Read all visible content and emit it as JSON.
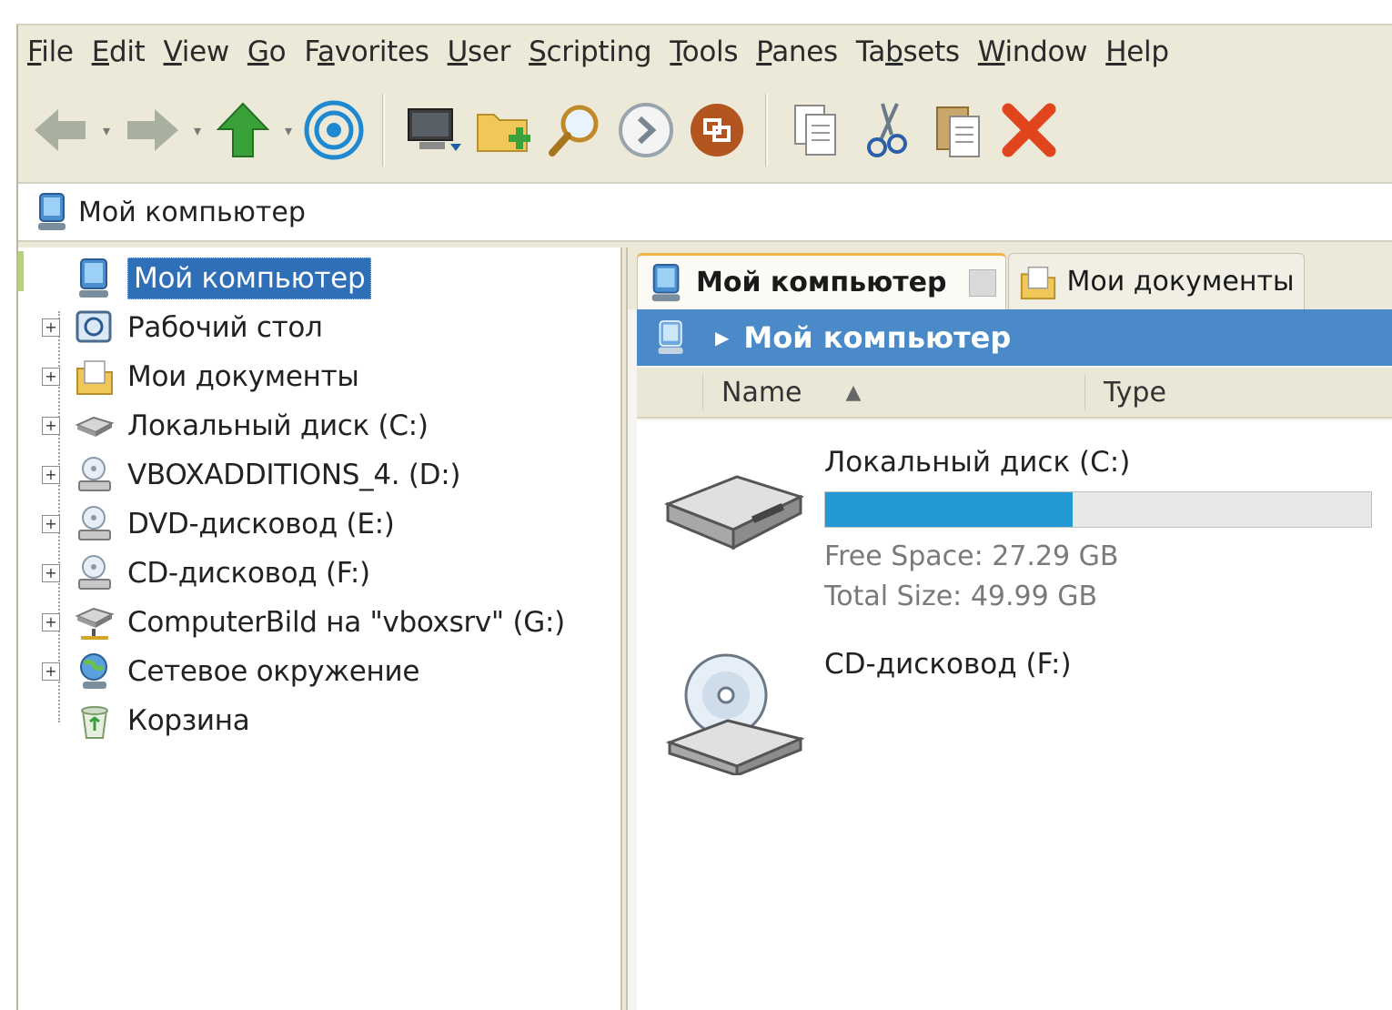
{
  "menu": [
    {
      "pre": "",
      "u": "F",
      "post": "ile"
    },
    {
      "pre": "",
      "u": "E",
      "post": "dit"
    },
    {
      "pre": "",
      "u": "V",
      "post": "iew"
    },
    {
      "pre": "",
      "u": "G",
      "post": "o"
    },
    {
      "pre": "F",
      "u": "a",
      "post": "vorites"
    },
    {
      "pre": "",
      "u": "U",
      "post": "ser"
    },
    {
      "pre": "",
      "u": "S",
      "post": "cripting"
    },
    {
      "pre": "",
      "u": "T",
      "post": "ools"
    },
    {
      "pre": "",
      "u": "P",
      "post": "anes"
    },
    {
      "pre": "Ta",
      "u": "b",
      "post": "sets"
    },
    {
      "pre": "",
      "u": "W",
      "post": "indow"
    },
    {
      "pre": "",
      "u": "H",
      "post": "elp"
    }
  ],
  "address": {
    "text": "Мой компьютер"
  },
  "tree": [
    {
      "label": "Мой компьютер",
      "selected": true,
      "icon": "computer-icon",
      "expander": false
    },
    {
      "label": "Рабочий стол",
      "icon": "desktop-icon",
      "expander": true
    },
    {
      "label": "Мои документы",
      "icon": "documents-icon",
      "expander": true
    },
    {
      "label": "Локальный диск (C:)",
      "icon": "hard-drive-icon",
      "expander": true
    },
    {
      "label": "VBOXADDITIONS_4. (D:)",
      "icon": "cd-drive-icon",
      "expander": true
    },
    {
      "label": "DVD-дисковод (E:)",
      "icon": "dvd-drive-icon",
      "expander": true
    },
    {
      "label": "CD-дисковод (F:)",
      "icon": "cd-drive-icon",
      "expander": true
    },
    {
      "label": "ComputerBild на \"vboxsrv\" (G:)",
      "icon": "network-drive-icon",
      "expander": true
    },
    {
      "label": "Сетевое окружение",
      "icon": "network-places-icon",
      "expander": true
    },
    {
      "label": "Корзина",
      "icon": "recycle-bin-icon",
      "expander": false
    }
  ],
  "tabs": [
    {
      "label": "Мой компьютер",
      "active": true
    },
    {
      "label": "Мои документы",
      "active": false
    }
  ],
  "location": {
    "text": "Мой компьютер"
  },
  "columns": {
    "name": "Name",
    "type": "Type",
    "sort_indicator": "▲"
  },
  "drives": [
    {
      "name": "Локальный диск (C:)",
      "free": "Free Space: 27.29 GB",
      "total": "Total Size: 49.99 GB",
      "used_fraction": 0.454
    },
    {
      "name": "CD-дисковод (F:)"
    }
  ],
  "colors": {
    "selection": "#2f6fb8",
    "location_bar": "#4a8ac9",
    "usage_bar": "#2399d4",
    "tab_accent": "#f4b34a"
  }
}
